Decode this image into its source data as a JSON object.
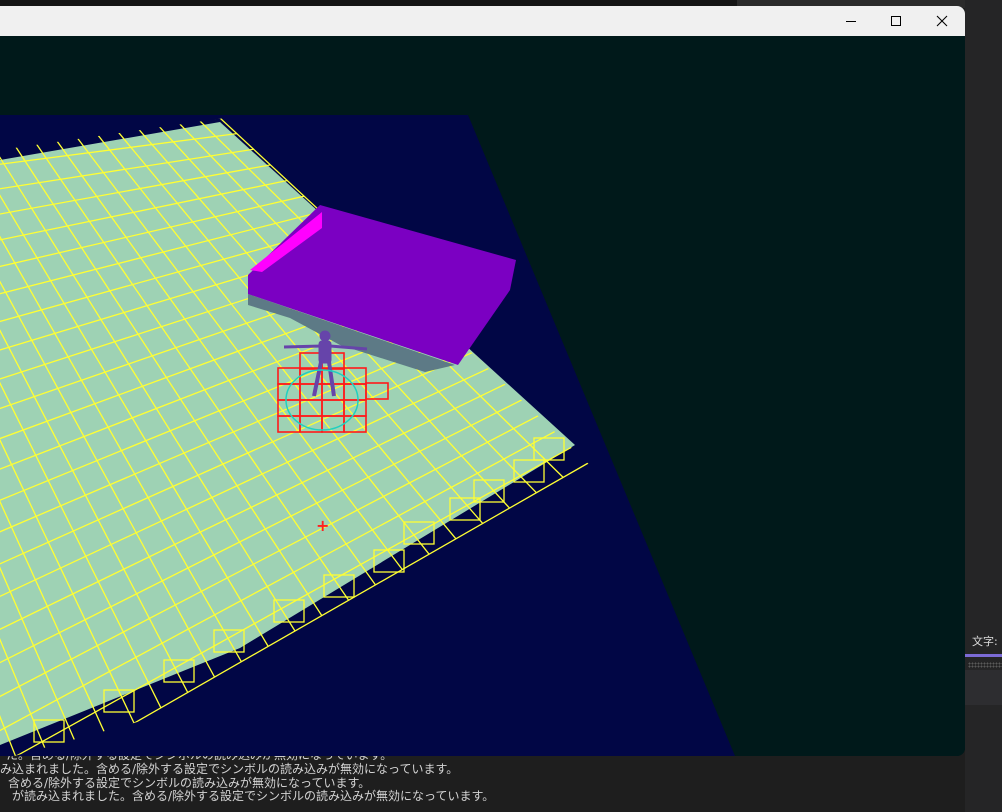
{
  "window": {
    "title": "",
    "controls": {
      "minimize": "minimize-icon",
      "maximize": "maximize-icon",
      "close": "close-icon"
    }
  },
  "scene": {
    "background_color": "#00191a",
    "ground_color": "#010645",
    "navmesh_fill": "#9ed2b4",
    "navmesh_grid_color": "#ffff33",
    "selected_grid_color": "#ff1a1a",
    "obstacle_color": "#7b00c2",
    "obstacle_edge_color": "#ff00ff",
    "character_color": "#6644aa",
    "cursor_marker": "+"
  },
  "side_panel": {
    "label": "文字:",
    "accent_color": "#7c6bd6"
  },
  "console": {
    "lines": [
      "た。含める/除外する設定でシンボルの読み込みが無効になっています。",
      "み込まれました。含める/除外する設定でシンボルの読み込みが無効になっています。",
      "含める/除外する設定でシンボルの読み込みが無効になっています。",
      "が読み込まれました。含める/除外する設定でシンボルの読み込みが無効になっています。"
    ]
  }
}
